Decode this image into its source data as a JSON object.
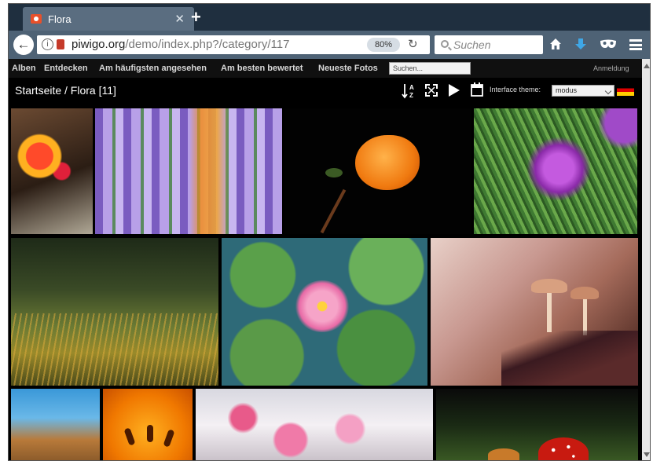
{
  "browser": {
    "tab_title": "Flora",
    "url_host": "piwigo.org",
    "url_path": "/demo/index.php?/category/117",
    "zoom": "80%",
    "search_placeholder": "Suchen"
  },
  "menubar": {
    "items": [
      "Alben",
      "Entdecken",
      "Am häufigsten angesehen",
      "Am besten bewertet",
      "Neueste Fotos"
    ],
    "search_value": "Suchen...",
    "login": "Anmeldung"
  },
  "titlebar": {
    "breadcrumb": "Startseite / Flora",
    "count": "[11]",
    "theme_label": "Interface theme:",
    "theme_value": "modus"
  },
  "gallery": {
    "photos": [
      {
        "subject": "red-lily"
      },
      {
        "subject": "lavender"
      },
      {
        "subject": "orange-rose"
      },
      {
        "subject": "thistle"
      },
      {
        "subject": "moss"
      },
      {
        "subject": "water-lily"
      },
      {
        "subject": "mushrooms"
      },
      {
        "subject": "coast"
      },
      {
        "subject": "orange-lily-closeup"
      },
      {
        "subject": "cherry-blossom"
      },
      {
        "subject": "fly-agaric"
      }
    ]
  },
  "colors": {
    "tab_strip": "#1f2f3f",
    "nav_bar": "#4e6275",
    "page_background": "#000000"
  }
}
